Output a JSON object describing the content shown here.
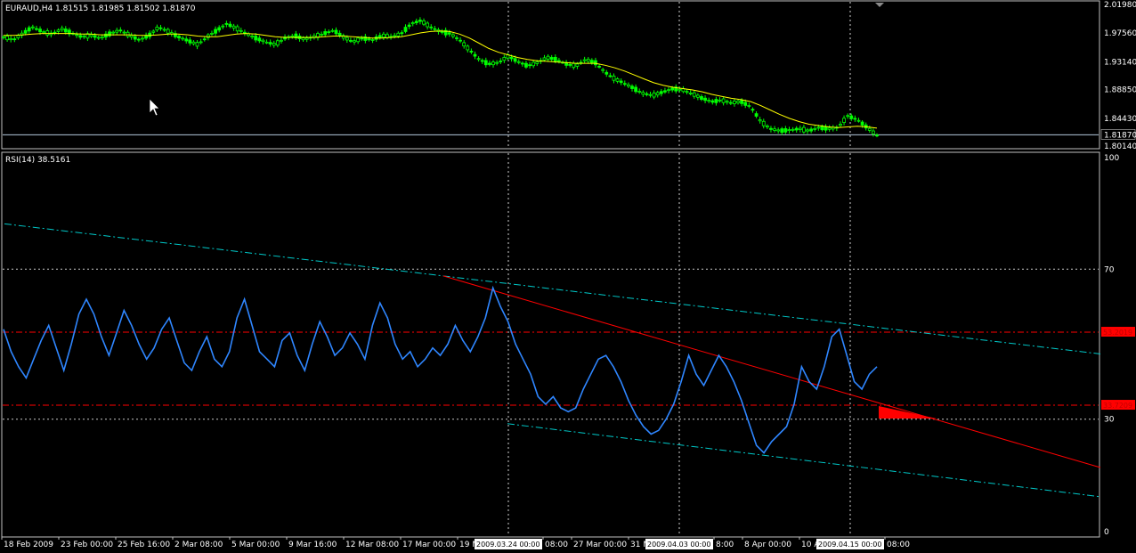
{
  "chart_data": [
    {
      "type": "candlestick",
      "title": "EURAUD,H4  1.81515 1.81985 1.81502 1.81870",
      "y_ticks": [
        "2.01980",
        "1.97560",
        "1.93140",
        "1.88850",
        "1.84430",
        "1.80140"
      ],
      "ylim": [
        1.8014,
        2.0198
      ],
      "last_price_label": "1.81870",
      "last_price": 1.8187,
      "candle_color": "#00ff00",
      "ma_color": "#ffff00",
      "price_series": [
        1.97,
        1.965,
        1.975,
        1.985,
        1.978,
        1.974,
        1.982,
        1.976,
        1.97,
        1.972,
        1.968,
        1.975,
        1.98,
        1.972,
        1.965,
        1.972,
        1.985,
        1.978,
        1.97,
        1.964,
        1.958,
        1.97,
        1.98,
        1.99,
        1.983,
        1.975,
        1.968,
        1.962,
        1.958,
        1.968,
        1.972,
        1.966,
        1.97,
        1.975,
        1.98,
        1.97,
        1.962,
        1.968,
        1.965,
        1.972,
        1.97,
        1.975,
        1.99,
        1.995,
        1.985,
        1.978,
        1.975,
        1.965,
        1.95,
        1.935,
        1.928,
        1.93,
        1.94,
        1.932,
        1.925,
        1.93,
        1.938,
        1.935,
        1.928,
        1.925,
        1.935,
        1.93,
        1.915,
        1.905,
        1.898,
        1.89,
        1.882,
        1.88,
        1.885,
        1.89,
        1.888,
        1.882,
        1.875,
        1.87,
        1.872,
        1.868,
        1.87,
        1.862,
        1.84,
        1.828,
        1.825,
        1.826,
        1.828,
        1.825,
        1.83,
        1.828,
        1.83,
        1.848,
        1.842,
        1.83,
        1.818
      ],
      "ma_series": [
        1.972,
        1.972,
        1.973,
        1.974,
        1.975,
        1.975,
        1.975,
        1.975,
        1.974,
        1.974,
        1.973,
        1.973,
        1.973,
        1.973,
        1.972,
        1.972,
        1.973,
        1.974,
        1.974,
        1.973,
        1.971,
        1.97,
        1.97,
        1.972,
        1.974,
        1.975,
        1.974,
        1.972,
        1.97,
        1.969,
        1.969,
        1.969,
        1.969,
        1.97,
        1.971,
        1.971,
        1.97,
        1.969,
        1.968,
        1.968,
        1.969,
        1.97,
        1.973,
        1.976,
        1.978,
        1.979,
        1.978,
        1.974,
        1.968,
        1.96,
        1.952,
        1.946,
        1.942,
        1.938,
        1.935,
        1.933,
        1.932,
        1.931,
        1.93,
        1.929,
        1.929,
        1.929,
        1.926,
        1.922,
        1.917,
        1.911,
        1.905,
        1.899,
        1.895,
        1.892,
        1.89,
        1.888,
        1.885,
        1.881,
        1.878,
        1.875,
        1.873,
        1.87,
        1.864,
        1.857,
        1.85,
        1.844,
        1.839,
        1.835,
        1.833,
        1.831,
        1.83,
        1.831,
        1.832,
        1.831,
        1.829
      ]
    },
    {
      "type": "line",
      "title": "RSI(14) 38.5161",
      "y_ticks": [
        "100",
        "70",
        "30",
        "0"
      ],
      "ylim": [
        0,
        100
      ],
      "levels": [
        70,
        30
      ],
      "level_labels": [
        "53.2019",
        "33.7209"
      ],
      "red_levels": [
        53.2019,
        33.7209
      ],
      "line_color": "#2f86ff",
      "trend_color": "#ff0000",
      "channel_color": "#00c8c8",
      "series": [
        {
          "name": "RSI(14)",
          "values": [
            54,
            48,
            44,
            41,
            46,
            51,
            55,
            49,
            43,
            50,
            58,
            62,
            58,
            52,
            47,
            53,
            59,
            55,
            50,
            46,
            49,
            54,
            57,
            51,
            45,
            43,
            48,
            52,
            46,
            44,
            48,
            57,
            62,
            55,
            48,
            46,
            44,
            51,
            53,
            47,
            43,
            50,
            56,
            52,
            47,
            49,
            53,
            50,
            46,
            55,
            61,
            57,
            50,
            46,
            48,
            44,
            46,
            49,
            47,
            50,
            55,
            51,
            48,
            52,
            57,
            65,
            60,
            56,
            50,
            46,
            42,
            36,
            34,
            36,
            33,
            32,
            33,
            38,
            42,
            46,
            47,
            44,
            40,
            35,
            31,
            28,
            26,
            27,
            30,
            34,
            40,
            47,
            42,
            39,
            43,
            47,
            44,
            40,
            35,
            29,
            23,
            21,
            24,
            26,
            28,
            34,
            44,
            40,
            38,
            44,
            52,
            54,
            47,
            40,
            38,
            42,
            44
          ]
        }
      ],
      "trendline": [
        [
          67,
          64.4
        ],
        [
          1236,
          17.1
        ]
      ],
      "channel_upper": [
        [
          5,
          82.1
        ],
        [
          1236,
          47.4
        ]
      ],
      "channel_lower": [
        [
          570,
          28.8
        ],
        [
          1236,
          9.3
        ]
      ]
    }
  ],
  "time_axis": {
    "ticks": [
      "18 Feb 2009",
      "23 Feb 00:00",
      "25 Feb 16:00",
      "2 Mar 08:00",
      "5 Mar 00:00",
      "9 Mar 16:00",
      "12 Mar 08:00",
      "17 Mar 00:00",
      "19 M",
      "08:00",
      "27 Mar 00:00",
      "31 M",
      "8:00",
      "8 Apr 00:00",
      "10 A",
      "08:00"
    ],
    "highlights": [
      "2009.03.24 00:00",
      "2009.04.03 00:00",
      "2009.04.15 00:00"
    ]
  }
}
